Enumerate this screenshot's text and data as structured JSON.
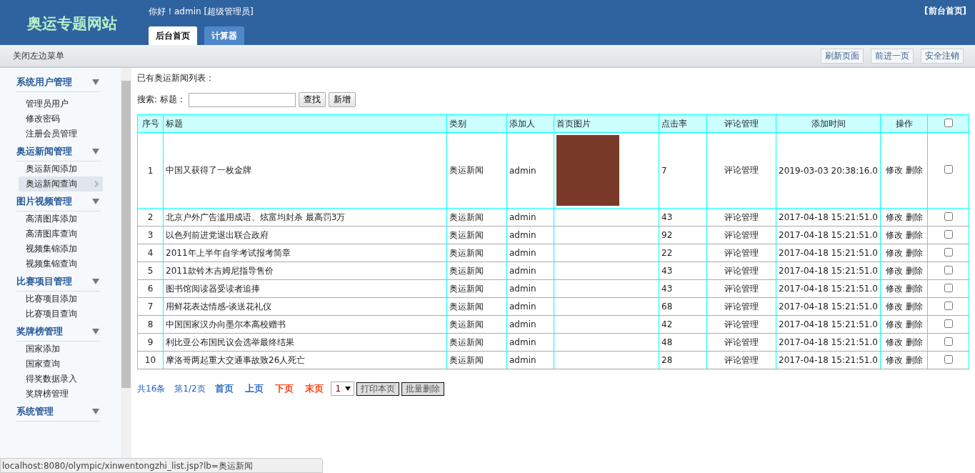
{
  "header": {
    "logo": "奥运专题网站",
    "greeting": "你好！admin [超级管理员]",
    "front_link": "[前台首页]",
    "tabs": [
      {
        "label": "后台首页",
        "selected": true
      },
      {
        "label": "计算器",
        "selected": false
      }
    ]
  },
  "toolbar": {
    "toggle_menu": "关闭左边菜单",
    "buttons": [
      "刷新页面",
      "前进一页",
      "安全注销"
    ]
  },
  "sidebar": {
    "groups": [
      {
        "title": "系统用户管理",
        "items": [
          {
            "label": "管理员用户",
            "selected": false
          },
          {
            "label": "修改密码",
            "selected": false
          },
          {
            "label": "注册会员管理",
            "selected": false
          }
        ]
      },
      {
        "title": "奥运新闻管理",
        "items": [
          {
            "label": "奥运新闻添加",
            "selected": false
          },
          {
            "label": "奥运新闻查询",
            "selected": true
          }
        ]
      },
      {
        "title": "图片视频管理",
        "items": [
          {
            "label": "高清图库添加",
            "selected": false
          },
          {
            "label": "高清图库查询",
            "selected": false
          },
          {
            "label": "视频集锦添加",
            "selected": false
          },
          {
            "label": "视频集锦查询",
            "selected": false
          }
        ]
      },
      {
        "title": "比赛项目管理",
        "items": [
          {
            "label": "比赛项目添加",
            "selected": false
          },
          {
            "label": "比赛项目查询",
            "selected": false
          }
        ]
      },
      {
        "title": "奖牌榜管理",
        "items": [
          {
            "label": "国家添加",
            "selected": false
          },
          {
            "label": "国家查询",
            "selected": false
          },
          {
            "label": "得奖数据录入",
            "selected": false
          },
          {
            "label": "奖牌榜管理",
            "selected": false
          }
        ]
      },
      {
        "title": "系统管理"
      }
    ]
  },
  "content": {
    "caption": "已有奥运新闻列表：",
    "search": {
      "label": "搜索: 标题：",
      "buttons": [
        "查找",
        "新增"
      ]
    },
    "table": {
      "columns": [
        "序号",
        "标题",
        "类别",
        "添加人",
        "首页图片",
        "点击率",
        "评论管理",
        "添加时间",
        "操作"
      ],
      "select_all_checked": false,
      "rows": [
        {
          "no": "1",
          "title": "中国又获得了一枚金牌",
          "category": "奥运新闻",
          "adder": "admin",
          "photo": true,
          "clicks": "7",
          "comments": "评论管理",
          "time": "2019-03-03 20:38:16.0",
          "actions": [
            "修改",
            "删除"
          ],
          "checked": false
        },
        {
          "no": "2",
          "title": "北京户外广告滥用成语、炫富均封杀 最高罚3万",
          "category": "奥运新闻",
          "adder": "admin",
          "photo": false,
          "clicks": "43",
          "comments": "评论管理",
          "time": "2017-04-18 15:21:51.0",
          "actions": [
            "修改",
            "删除"
          ],
          "checked": false
        },
        {
          "no": "3",
          "title": "以色列前进党退出联合政府",
          "category": "奥运新闻",
          "adder": "admin",
          "photo": false,
          "clicks": "92",
          "comments": "评论管理",
          "time": "2017-04-18 15:21:51.0",
          "actions": [
            "修改",
            "删除"
          ],
          "checked": false
        },
        {
          "no": "4",
          "title": "2011年上半年自学考试报考简章",
          "category": "奥运新闻",
          "adder": "admin",
          "photo": false,
          "clicks": "22",
          "comments": "评论管理",
          "time": "2017-04-18 15:21:51.0",
          "actions": [
            "修改",
            "删除"
          ],
          "checked": false
        },
        {
          "no": "5",
          "title": "2011款铃木吉姆尼指导售价",
          "category": "奥运新闻",
          "adder": "admin",
          "photo": false,
          "clicks": "43",
          "comments": "评论管理",
          "time": "2017-04-18 15:21:51.0",
          "actions": [
            "修改",
            "删除"
          ],
          "checked": false
        },
        {
          "no": "6",
          "title": "图书馆阅读器受读者追捧",
          "category": "奥运新闻",
          "adder": "admin",
          "photo": false,
          "clicks": "43",
          "comments": "评论管理",
          "time": "2017-04-18 15:21:51.0",
          "actions": [
            "修改",
            "删除"
          ],
          "checked": false
        },
        {
          "no": "7",
          "title": "用鲜花表达情感-谈送花礼仪",
          "category": "奥运新闻",
          "adder": "admin",
          "photo": false,
          "clicks": "68",
          "comments": "评论管理",
          "time": "2017-04-18 15:21:51.0",
          "actions": [
            "修改",
            "删除"
          ],
          "checked": false
        },
        {
          "no": "8",
          "title": "中国国家汉办向墨尔本高校赠书",
          "category": "奥运新闻",
          "adder": "admin",
          "photo": false,
          "clicks": "42",
          "comments": "评论管理",
          "time": "2017-04-18 15:21:51.0",
          "actions": [
            "修改",
            "删除"
          ],
          "checked": false
        },
        {
          "no": "9",
          "title": "利比亚公布国民议会选举最终结果",
          "category": "奥运新闻",
          "adder": "admin",
          "photo": false,
          "clicks": "48",
          "comments": "评论管理",
          "time": "2017-04-18 15:21:51.0",
          "actions": [
            "修改",
            "删除"
          ],
          "checked": false
        },
        {
          "no": "10",
          "title": "摩洛哥两起重大交通事故致26人死亡",
          "category": "奥运新闻",
          "adder": "admin",
          "photo": false,
          "clicks": "28",
          "comments": "评论管理",
          "time": "2017-04-18 15:21:51.0",
          "actions": [
            "修改",
            "删除"
          ],
          "checked": false
        }
      ]
    },
    "pagination": {
      "total": "共16条",
      "page_info": "第1/2页",
      "links": [
        {
          "label": "首页",
          "color": "#1f5fbf"
        },
        {
          "label": "上页",
          "color": "#1f5fbf"
        },
        {
          "label": "下页",
          "color": "#ff3300"
        },
        {
          "label": "末页",
          "color": "#ff3300"
        }
      ],
      "page_select": "1",
      "buttons": [
        "打印本页",
        "批量删除"
      ]
    }
  },
  "status_bar": "localhost:8080/olympic/xinwentongzhi_list.jsp?lb=奥运新闻"
}
